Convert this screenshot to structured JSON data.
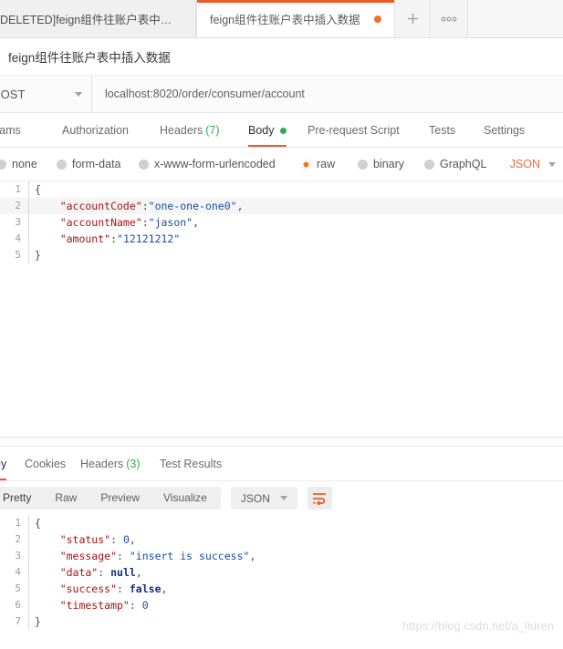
{
  "tabbar": {
    "tabs": [
      {
        "label": "DELETED]feign组件往账户表中插入...",
        "active": false,
        "unsaved": false
      },
      {
        "label": "feign组件往账户表中插入数据",
        "active": true,
        "unsaved": true
      }
    ],
    "new_tab_label": "+",
    "more_label": "000"
  },
  "request": {
    "name": "feign组件往账户表中插入数据",
    "method": "POST",
    "url": "localhost:8020/order/consumer/account",
    "tabs": [
      {
        "label": "arams",
        "count": "",
        "active": false
      },
      {
        "label": "Authorization",
        "count": "",
        "active": false
      },
      {
        "label": "Headers",
        "count": "(7)",
        "active": false
      },
      {
        "label": "Body",
        "count": "",
        "active": true
      },
      {
        "label": "Pre-request Script",
        "count": "",
        "active": false
      },
      {
        "label": "Tests",
        "count": "",
        "active": false
      },
      {
        "label": "Settings",
        "count": "",
        "active": false
      }
    ],
    "body_types": [
      {
        "label": "none",
        "selected": false
      },
      {
        "label": "form-data",
        "selected": false
      },
      {
        "label": "x-www-form-urlencoded",
        "selected": false
      },
      {
        "label": "raw",
        "selected": true
      },
      {
        "label": "binary",
        "selected": false
      },
      {
        "label": "GraphQL",
        "selected": false
      }
    ],
    "body_format": "JSON",
    "body_lines": [
      {
        "n": "1",
        "highlight": false,
        "tokens": [
          {
            "t": "punc",
            "v": "{"
          }
        ]
      },
      {
        "n": "2",
        "highlight": true,
        "tokens": [
          {
            "t": "key",
            "v": "    \"accountCode\""
          },
          {
            "t": "punc",
            "v": ":"
          },
          {
            "t": "str",
            "v": "\"one-one-one0\""
          },
          {
            "t": "punc",
            "v": ","
          }
        ]
      },
      {
        "n": "3",
        "highlight": false,
        "tokens": [
          {
            "t": "key",
            "v": "    \"accountName\""
          },
          {
            "t": "punc",
            "v": ":"
          },
          {
            "t": "str",
            "v": "\"jason\""
          },
          {
            "t": "punc",
            "v": ","
          }
        ]
      },
      {
        "n": "4",
        "highlight": false,
        "tokens": [
          {
            "t": "key",
            "v": "    \"amount\""
          },
          {
            "t": "punc",
            "v": ":"
          },
          {
            "t": "str",
            "v": "\"12121212\""
          }
        ]
      },
      {
        "n": "5",
        "highlight": false,
        "tokens": [
          {
            "t": "punc",
            "v": "}"
          }
        ]
      }
    ]
  },
  "response": {
    "tabs": [
      {
        "label": "dy",
        "count": "",
        "active": true
      },
      {
        "label": "Cookies",
        "count": "",
        "active": false
      },
      {
        "label": "Headers",
        "count": "(3)",
        "active": false
      },
      {
        "label": "Test Results",
        "count": "",
        "active": false
      }
    ],
    "view_modes": [
      {
        "label": "Pretty",
        "active": true
      },
      {
        "label": "Raw",
        "active": false
      },
      {
        "label": "Preview",
        "active": false
      },
      {
        "label": "Visualize",
        "active": false
      }
    ],
    "format": "JSON",
    "wrap_icon": "word-wrap-icon",
    "body_lines": [
      {
        "n": "1",
        "highlight": false,
        "tokens": [
          {
            "t": "punc",
            "v": "{"
          }
        ]
      },
      {
        "n": "2",
        "highlight": false,
        "tokens": [
          {
            "t": "key",
            "v": "    \"status\""
          },
          {
            "t": "punc",
            "v": ": "
          },
          {
            "t": "num",
            "v": "0"
          },
          {
            "t": "punc",
            "v": ","
          }
        ]
      },
      {
        "n": "3",
        "highlight": false,
        "tokens": [
          {
            "t": "key",
            "v": "    \"message\""
          },
          {
            "t": "punc",
            "v": ": "
          },
          {
            "t": "str",
            "v": "\"insert is success\""
          },
          {
            "t": "punc",
            "v": ","
          }
        ]
      },
      {
        "n": "4",
        "highlight": false,
        "tokens": [
          {
            "t": "key",
            "v": "    \"data\""
          },
          {
            "t": "punc",
            "v": ": "
          },
          {
            "t": "kw",
            "v": "null"
          },
          {
            "t": "punc",
            "v": ","
          }
        ]
      },
      {
        "n": "5",
        "highlight": false,
        "tokens": [
          {
            "t": "key",
            "v": "    \"success\""
          },
          {
            "t": "punc",
            "v": ": "
          },
          {
            "t": "kw",
            "v": "false"
          },
          {
            "t": "punc",
            "v": ","
          }
        ]
      },
      {
        "n": "6",
        "highlight": false,
        "tokens": [
          {
            "t": "key",
            "v": "    \"timestamp\""
          },
          {
            "t": "punc",
            "v": ": "
          },
          {
            "t": "num",
            "v": "0"
          }
        ]
      },
      {
        "n": "7",
        "highlight": false,
        "tokens": [
          {
            "t": "punc",
            "v": "}"
          }
        ]
      }
    ]
  },
  "watermark": "https://blog.csdn.net/a_liuren",
  "colors": {
    "accent_orange": "#ef5b25",
    "green": "#2eab51",
    "json_orange": "#f2693c"
  }
}
